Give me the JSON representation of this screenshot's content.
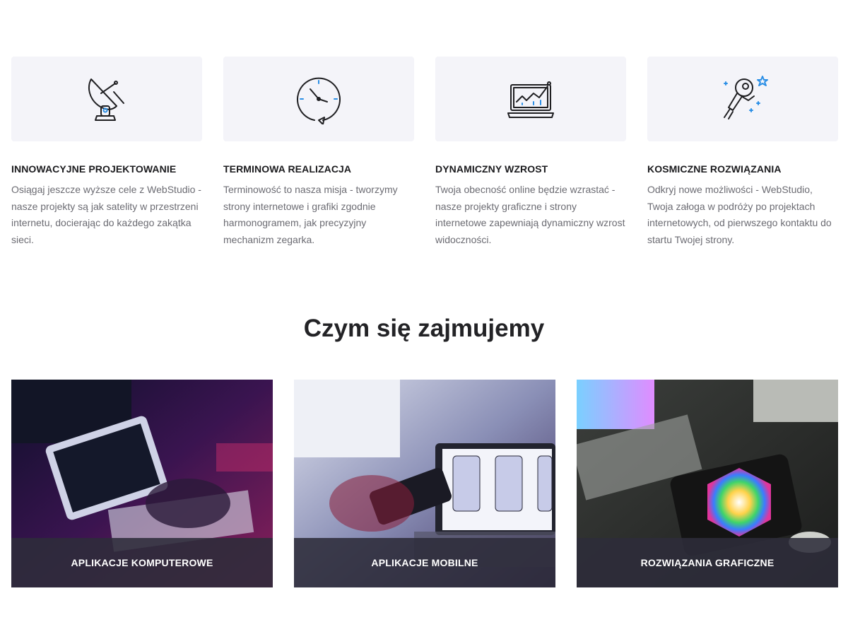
{
  "features": [
    {
      "icon": "satellite-dish-icon",
      "title": "INNOWACYJNE PROJEKTOWANIE",
      "text": "Osiągaj jeszcze wyższe cele z WebStudio - nasze projekty są jak satelity w przestrzeni internetu, docierając do każdego zakątka sieci."
    },
    {
      "icon": "clock-icon",
      "title": "TERMINOWA REALIZACJA",
      "text": "Terminowość to nasza misja - tworzymy strony internetowe i grafiki zgodnie harmonogramem, jak precyzyjny mechanizm zegarka."
    },
    {
      "icon": "laptop-chart-icon",
      "title": "DYNAMICZNY WZROST",
      "text": "Twoja obecność online będzie wzrastać - nasze projekty graficzne i strony internetowe zapewniają dynamiczny wzrost widoczności."
    },
    {
      "icon": "astronaut-icon",
      "title": "KOSMICZNE ROZWIĄZANIA",
      "text": "Odkryj nowe możliwości - WebStudio, Twoja załoga w podróży po projektach internetowych, od pierwszego kontaktu do startu Twojej strony."
    }
  ],
  "section_title": "Czym się zajmujemy",
  "services": [
    {
      "label": "APLIKACJE KOMPUTEROWE"
    },
    {
      "label": "APLIKACJE MOBILNE"
    },
    {
      "label": "ROZWIĄZANIA GRAFICZNE"
    }
  ],
  "colors": {
    "icon_stroke": "#1f1f22",
    "icon_accent": "#2b8fe6",
    "card_bg": "#f4f4f9",
    "overlay": "#2d2c3a"
  }
}
